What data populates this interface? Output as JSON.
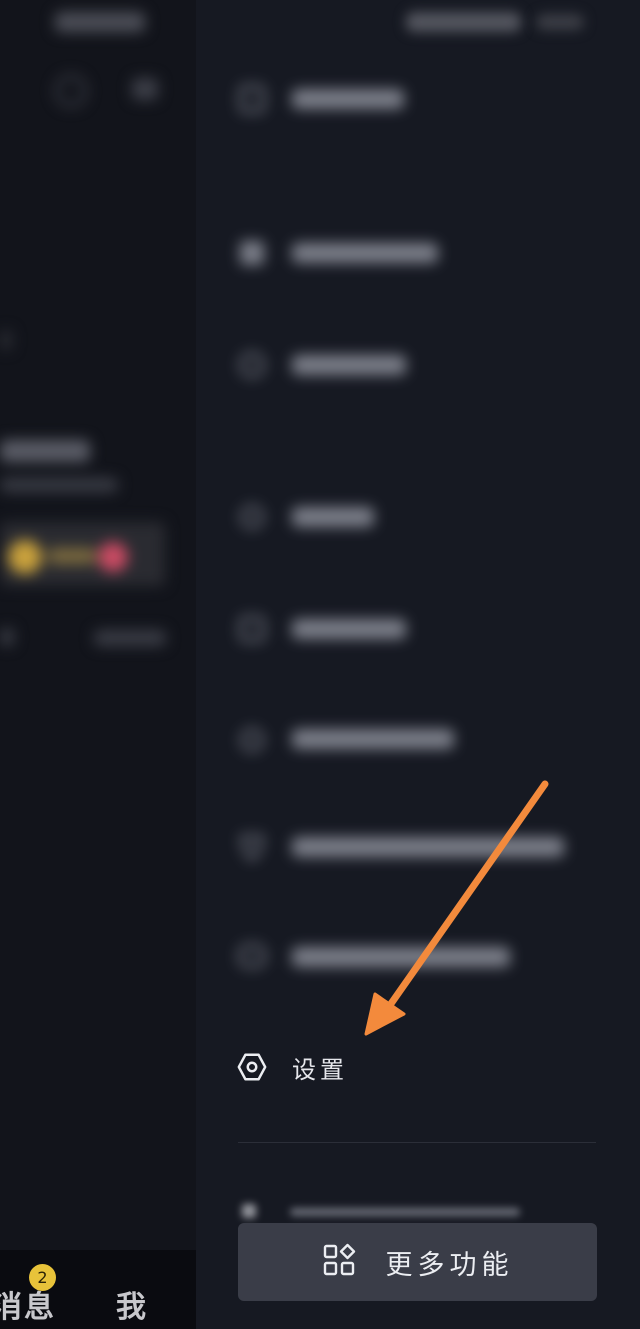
{
  "background_app": {
    "tabs": {
      "message_label": "消息",
      "me_label": "我"
    },
    "message_badge": "2"
  },
  "drawer": {
    "settings_label": "设置",
    "more_features_label": "更多功能"
  },
  "colors": {
    "accent_arrow": "#f38a3c",
    "badge": "#e8c33a",
    "drawer_bg": "#161922",
    "button_bg": "#3a3d48"
  }
}
